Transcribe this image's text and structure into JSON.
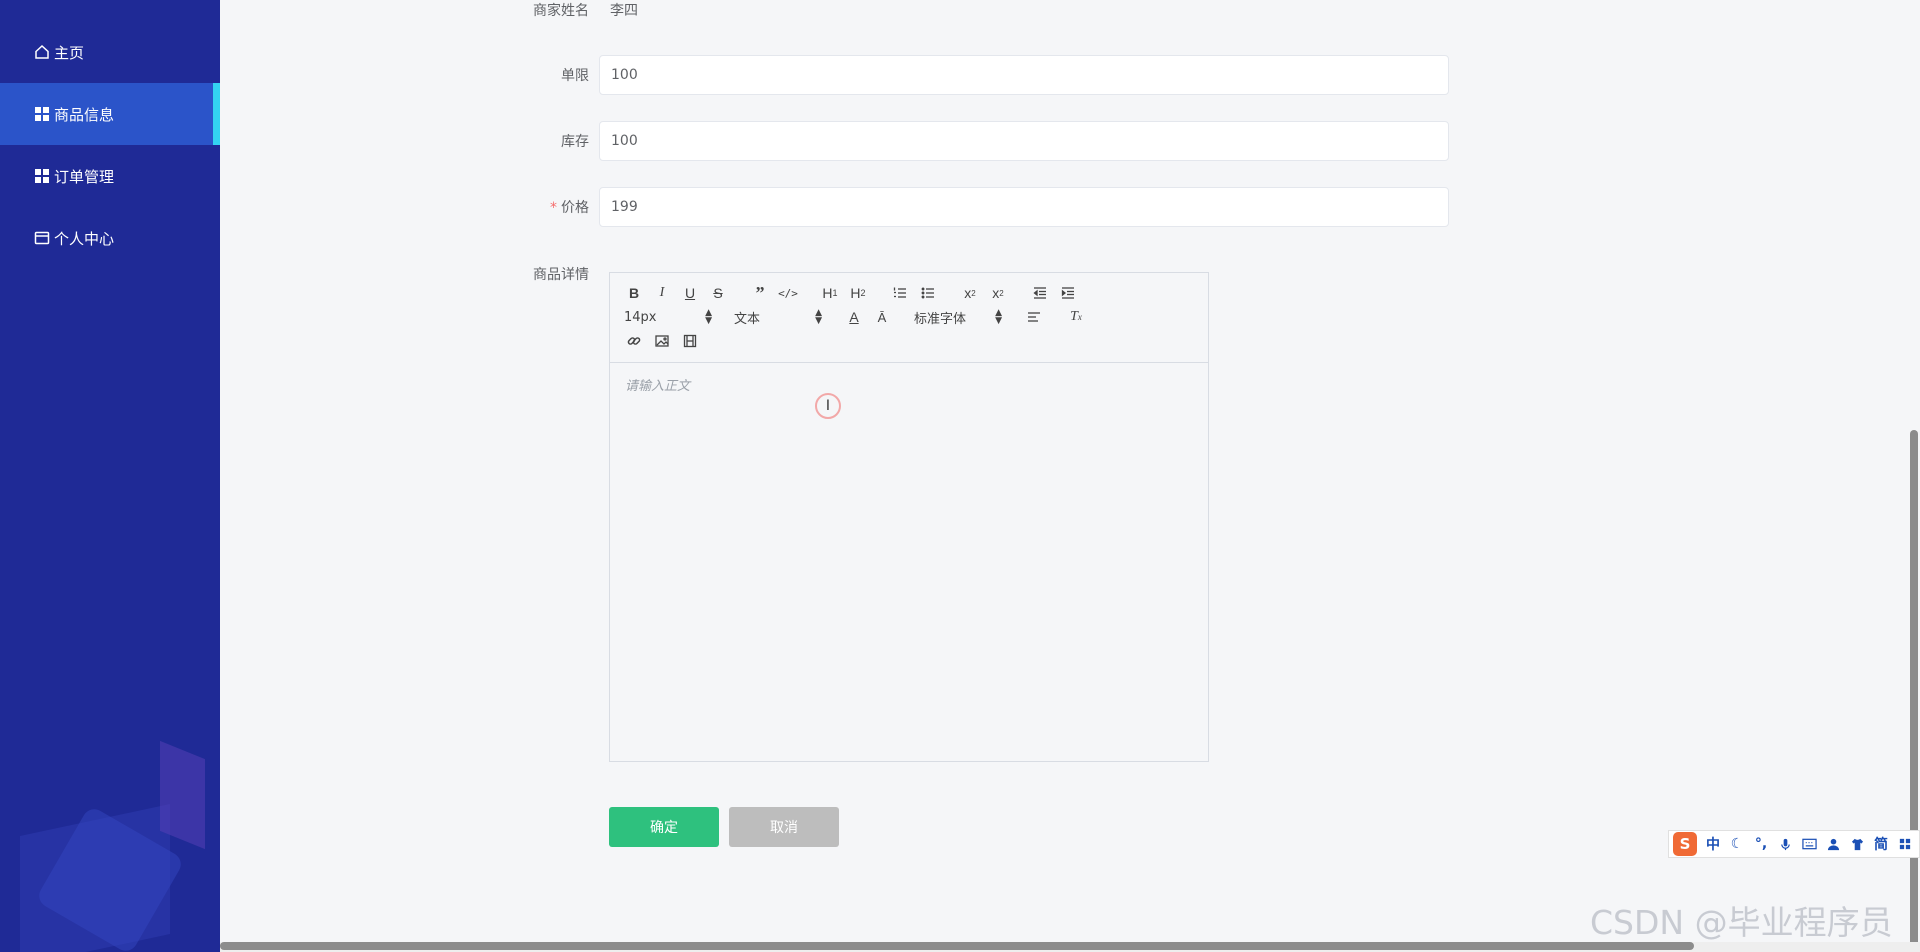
{
  "sidebar": {
    "items": [
      {
        "label": "主页",
        "icon": "home-icon"
      },
      {
        "label": "商品信息",
        "icon": "grid-icon",
        "active": true
      },
      {
        "label": "订单管理",
        "icon": "grid-icon"
      },
      {
        "label": "个人中心",
        "icon": "card-icon"
      }
    ]
  },
  "form": {
    "merchant_name_label": "商家姓名",
    "merchant_name_value": "李四",
    "limit_label": "单限",
    "limit_value": "100",
    "stock_label": "库存",
    "stock_value": "100",
    "price_required_mark": "*",
    "price_label": "价格",
    "price_value": "199",
    "detail_label": "商品详情"
  },
  "editor": {
    "toolbar": {
      "font_size": "14px",
      "header": "文本",
      "font_family": "标准字体"
    },
    "placeholder": "请输入正文"
  },
  "buttons": {
    "confirm_label": "确定",
    "cancel_label": "取消"
  },
  "ime": {
    "items": [
      "中",
      "简"
    ]
  },
  "watermark": "CSDN @毕业程序员",
  "colors": {
    "sidebar_bg": "#1f2a96",
    "sidebar_active_bg": "#2b54c9",
    "sidebar_active_indicator": "#33d4f2",
    "confirm_button": "#2ec17e",
    "cancel_button": "#bdbdbd",
    "required_mark": "#f56c6c"
  }
}
